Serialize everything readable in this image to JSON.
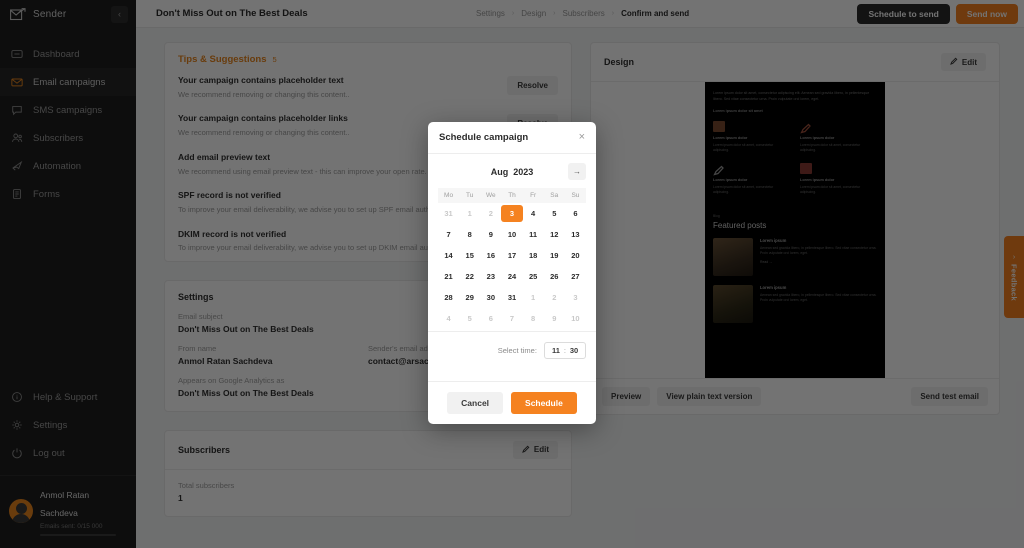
{
  "sidebar": {
    "brand": "Sender",
    "collapse_icon": "chevron-left-icon",
    "items": [
      {
        "label": "Dashboard",
        "icon": "dashboard-icon",
        "active": false
      },
      {
        "label": "Email campaigns",
        "icon": "envelope-icon",
        "active": true
      },
      {
        "label": "SMS campaigns",
        "icon": "chat-bubble-icon",
        "active": false
      },
      {
        "label": "Subscribers",
        "icon": "users-icon",
        "active": false
      },
      {
        "label": "Automation",
        "icon": "rocket-icon",
        "active": false
      },
      {
        "label": "Forms",
        "icon": "form-icon",
        "active": false
      }
    ],
    "bottom_items": [
      {
        "label": "Help & Support",
        "icon": "info-circle-icon"
      },
      {
        "label": "Settings",
        "icon": "gear-icon"
      },
      {
        "label": "Log out",
        "icon": "power-icon"
      }
    ],
    "user": {
      "name": "Anmol Ratan Sachdeva",
      "meta": "Emails sent: 0/15 000"
    }
  },
  "topbar": {
    "campaign_title": "Don't Miss Out on The Best Deals",
    "steps": [
      {
        "label": "Settings",
        "current": false
      },
      {
        "label": "Design",
        "current": false
      },
      {
        "label": "Subscribers",
        "current": false
      },
      {
        "label": "Confirm and send",
        "current": true
      }
    ],
    "schedule_button": "Schedule to send",
    "send_button": "Send now"
  },
  "tips": {
    "title": "Tips & Suggestions",
    "count": "5",
    "resolve_label": "Resolve",
    "items": [
      {
        "title": "Your campaign contains placeholder text",
        "desc": "We recommend removing or changing this content..",
        "has_resolve": true
      },
      {
        "title": "Your campaign contains placeholder links",
        "desc": "We recommend removing or changing this content..",
        "has_resolve": true
      },
      {
        "title": "Add email preview text",
        "desc": "We recommend using email preview text - this can improve your open rate.",
        "has_resolve": false
      },
      {
        "title": "SPF record is not verified",
        "desc": "To improve your email deliverability, we advise you to set up SPF email authentication.",
        "has_resolve": false
      },
      {
        "title": "DKIM record is not verified",
        "desc": "To improve your email deliverability, we advise you to set up DKIM email authentication.",
        "has_resolve": false
      }
    ]
  },
  "settings_section": {
    "title": "Settings",
    "subject_label": "Email subject",
    "subject_value": "Don't Miss Out on The Best Deals",
    "from_name_label": "From name",
    "from_name_value": "Anmol Ratan Sachdeva",
    "sender_email_label": "Sender's email address",
    "sender_email_value": "contact@arsachdeva.com",
    "analytics_label": "Appears on Google Analytics as",
    "analytics_value": "Don't Miss Out on The Best Deals"
  },
  "subscribers_section": {
    "title": "Subscribers",
    "edit_label": "Edit",
    "total_label": "Total subscribers",
    "total_value": "1"
  },
  "design_section": {
    "title": "Design",
    "edit_label": "Edit",
    "preview_button": "Preview",
    "plain_text_button": "View plain text version",
    "send_test_button": "Send test email",
    "email_preview": {
      "intro": "Lorem ipsum dolor sit amet, consectetur adipiscing elit. Aenean sed gravida libero, in pellentesque libero. Sed vitae consectetur urna. Proin vulputate orci lorem, eget.",
      "sub_heading": "Lorem ipsum dolor sit amet",
      "features": [
        {
          "title": "Lorem ipsum dolor",
          "desc": "Lorem ipsum dolor sit amet, consectetur adipiscing.",
          "icon": "grid-icon"
        },
        {
          "title": "Lorem ipsum dolor",
          "desc": "Lorem ipsum dolor sit amet, consectetur adipiscing.",
          "icon": "pen-icon"
        },
        {
          "title": "Lorem ipsum dolor",
          "desc": "Lorem ipsum dolor sit amet, consectetur adipiscing.",
          "icon": "pencil-icon"
        },
        {
          "title": "Lorem ipsum dolor",
          "desc": "Lorem ipsum dolor sit amet, consectetur adipiscing.",
          "icon": "columns-icon"
        }
      ],
      "blog_kicker": "Blog",
      "blog_heading": "Featured posts",
      "posts": [
        {
          "title": "Lorem ipsum",
          "desc": "Aenean sed gravida libero, in pellentesque libero. Sed vitae consectetur urna. Proin vulputate orci lorem, eget.",
          "read_more": "Read →"
        },
        {
          "title": "Lorem ipsum",
          "desc": "Aenean sed gravida libero, in pellentesque libero. Sed vitae consectetur urna. Proin vulputate orci lorem, eget.",
          "read_more": ""
        }
      ]
    }
  },
  "feedback_tab": {
    "label": "Feedback",
    "icon": "chevron-right-icon"
  },
  "modal": {
    "title": "Schedule campaign",
    "close_icon": "close-icon",
    "next_month_icon": "arrow-right-icon",
    "month": "Aug",
    "year": "2023",
    "weekdays": [
      "Mo",
      "Tu",
      "We",
      "Th",
      "Fr",
      "Sa",
      "Su"
    ],
    "weeks": [
      [
        {
          "d": "31",
          "muted": true,
          "sel": false
        },
        {
          "d": "1",
          "muted": true,
          "sel": false
        },
        {
          "d": "2",
          "muted": true,
          "sel": false
        },
        {
          "d": "3",
          "muted": false,
          "sel": true
        },
        {
          "d": "4",
          "muted": false,
          "sel": false
        },
        {
          "d": "5",
          "muted": false,
          "sel": false
        },
        {
          "d": "6",
          "muted": false,
          "sel": false
        }
      ],
      [
        {
          "d": "7",
          "muted": false,
          "sel": false
        },
        {
          "d": "8",
          "muted": false,
          "sel": false
        },
        {
          "d": "9",
          "muted": false,
          "sel": false
        },
        {
          "d": "10",
          "muted": false,
          "sel": false
        },
        {
          "d": "11",
          "muted": false,
          "sel": false
        },
        {
          "d": "12",
          "muted": false,
          "sel": false
        },
        {
          "d": "13",
          "muted": false,
          "sel": false
        }
      ],
      [
        {
          "d": "14",
          "muted": false,
          "sel": false
        },
        {
          "d": "15",
          "muted": false,
          "sel": false
        },
        {
          "d": "16",
          "muted": false,
          "sel": false
        },
        {
          "d": "17",
          "muted": false,
          "sel": false
        },
        {
          "d": "18",
          "muted": false,
          "sel": false
        },
        {
          "d": "19",
          "muted": false,
          "sel": false
        },
        {
          "d": "20",
          "muted": false,
          "sel": false
        }
      ],
      [
        {
          "d": "21",
          "muted": false,
          "sel": false
        },
        {
          "d": "22",
          "muted": false,
          "sel": false
        },
        {
          "d": "23",
          "muted": false,
          "sel": false
        },
        {
          "d": "24",
          "muted": false,
          "sel": false
        },
        {
          "d": "25",
          "muted": false,
          "sel": false
        },
        {
          "d": "26",
          "muted": false,
          "sel": false
        },
        {
          "d": "27",
          "muted": false,
          "sel": false
        }
      ],
      [
        {
          "d": "28",
          "muted": false,
          "sel": false
        },
        {
          "d": "29",
          "muted": false,
          "sel": false
        },
        {
          "d": "30",
          "muted": false,
          "sel": false
        },
        {
          "d": "31",
          "muted": false,
          "sel": false
        },
        {
          "d": "1",
          "muted": true,
          "sel": false
        },
        {
          "d": "2",
          "muted": true,
          "sel": false
        },
        {
          "d": "3",
          "muted": true,
          "sel": false
        }
      ],
      [
        {
          "d": "4",
          "muted": true,
          "sel": false
        },
        {
          "d": "5",
          "muted": true,
          "sel": false
        },
        {
          "d": "6",
          "muted": true,
          "sel": false
        },
        {
          "d": "7",
          "muted": true,
          "sel": false
        },
        {
          "d": "8",
          "muted": true,
          "sel": false
        },
        {
          "d": "9",
          "muted": true,
          "sel": false
        },
        {
          "d": "10",
          "muted": true,
          "sel": false
        }
      ]
    ],
    "time_label": "Select time:",
    "time_hour": "11",
    "time_minute": "30",
    "cancel_label": "Cancel",
    "schedule_label": "Schedule"
  },
  "colors": {
    "accent": "#f58220",
    "accent_text": "#e8861e",
    "sidebar_bg": "#1d1d1d",
    "dark_button": "#2b2b2b"
  }
}
